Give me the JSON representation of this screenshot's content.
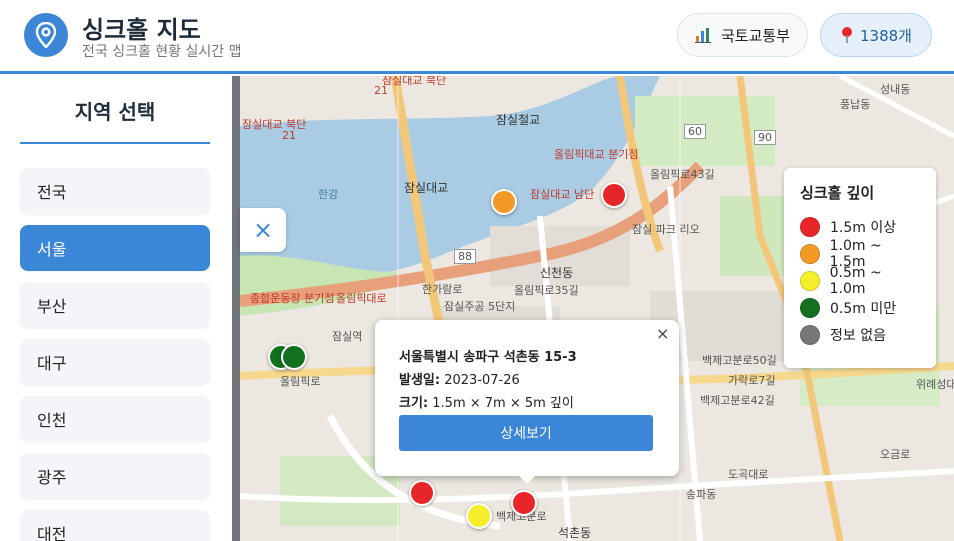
{
  "header": {
    "title": "싱크홀 지도",
    "subtitle": "전국 싱크홀 현황 실시간 맵",
    "ministry_button": "국토교통부",
    "count_button": "1388개"
  },
  "sidebar": {
    "heading": "지역 선택",
    "regions": [
      {
        "label": "전국",
        "active": false
      },
      {
        "label": "서울",
        "active": true
      },
      {
        "label": "부산",
        "active": false
      },
      {
        "label": "대구",
        "active": false
      },
      {
        "label": "인천",
        "active": false
      },
      {
        "label": "광주",
        "active": false
      },
      {
        "label": "대전",
        "active": false
      }
    ]
  },
  "map": {
    "labels": [
      "잠실대교 북단",
      "21",
      "잠실대교 북단",
      "21",
      "잠실철교",
      "올림픽대교 분기점",
      "잠실대교",
      "한강",
      "잠실대교 남단",
      "올림픽로43길",
      "잠실 파크 리오",
      "60",
      "90",
      "88",
      "신천동",
      "한가람로",
      "종합운동장 분기점",
      "올림픽대로",
      "잠실주공 5단지",
      "올림픽로35길",
      "잠실역",
      "올림픽로",
      "석촌동",
      "백제고분로",
      "송파동",
      "백제고분로50길",
      "가락로7길",
      "백제고분로42길",
      "위례성대로",
      "오금로",
      "성내동",
      "풍납동",
      "도곡대로"
    ]
  },
  "legend": {
    "title": "싱크홀 깊이",
    "items": [
      {
        "label": "1.5m 이상",
        "color": "#e8262a"
      },
      {
        "label": "1.0m ~ 1.5m",
        "color": "#f39a26"
      },
      {
        "label": "0.5m ~ 1.0m",
        "color": "#f4ef2a"
      },
      {
        "label": "0.5m 미만",
        "color": "#13701e"
      },
      {
        "label": "정보 없음",
        "color": "#777777"
      }
    ]
  },
  "popup": {
    "address": "서울특별시 송파구 석촌동 15-3",
    "date_label": "발생일:",
    "date_value": "2023-07-26",
    "size_label": "크기:",
    "size_value": "1.5m × 7m × 5m 깊이",
    "detail_button": "상세보기",
    "close_glyph": "×"
  },
  "close_tab_glyph": "×",
  "colors": {
    "accent": "#3b86d6"
  }
}
